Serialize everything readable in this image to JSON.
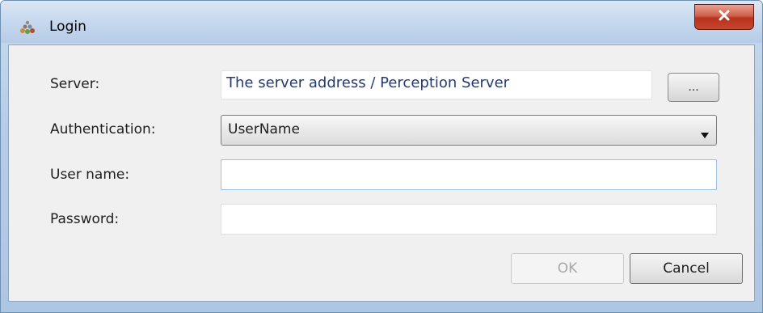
{
  "window": {
    "title": "Login",
    "icon": "login-app-icon",
    "close_label": "x"
  },
  "form": {
    "server_label": "Server:",
    "server_value": "The server address / Perception Server",
    "browse_label": "...",
    "authentication_label": "Authentication:",
    "authentication_value": "UserName",
    "username_label": "User name:",
    "username_value": "",
    "password_label": "Password:",
    "password_value": ""
  },
  "buttons": {
    "ok_label": "OK",
    "cancel_label": "Cancel"
  },
  "colors": {
    "close_button": "#c9452e",
    "server_text": "#243b72",
    "focus_border": "#9fc2e8"
  }
}
